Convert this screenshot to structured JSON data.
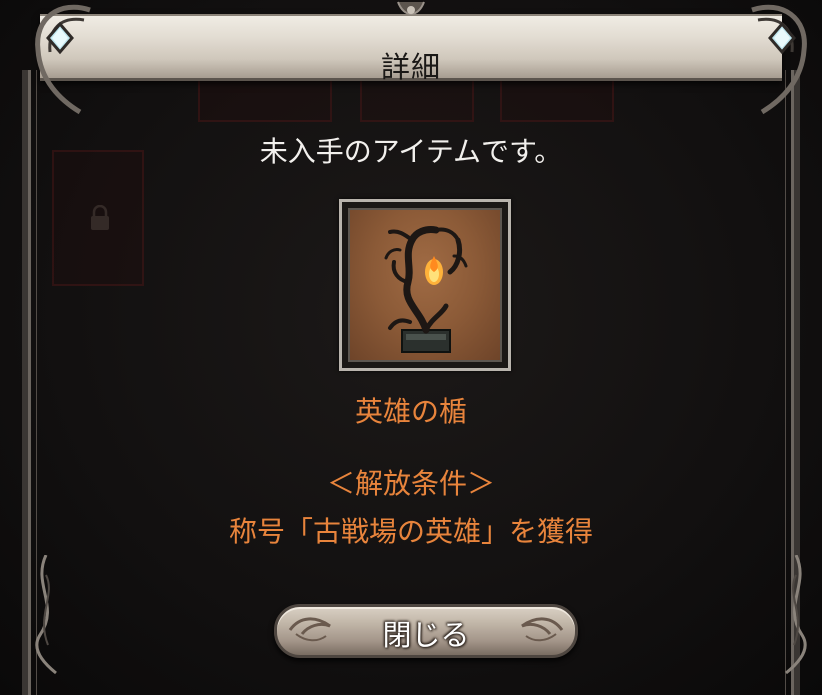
{
  "dialog": {
    "title": "詳細",
    "message": "未入手のアイテムです。",
    "item": {
      "name": "英雄の楯",
      "icon": "trophy-tree-flame-icon"
    },
    "unlock": {
      "header": "＜解放条件＞",
      "condition": "称号「古戦場の英雄」を獲得"
    },
    "close_label": "閉じる"
  },
  "colors": {
    "accent_orange": "#e8843c",
    "text_white": "#f2f0ed",
    "banner": "#e2dcd2",
    "background": "#121010",
    "gem": "#bfe6ee"
  }
}
